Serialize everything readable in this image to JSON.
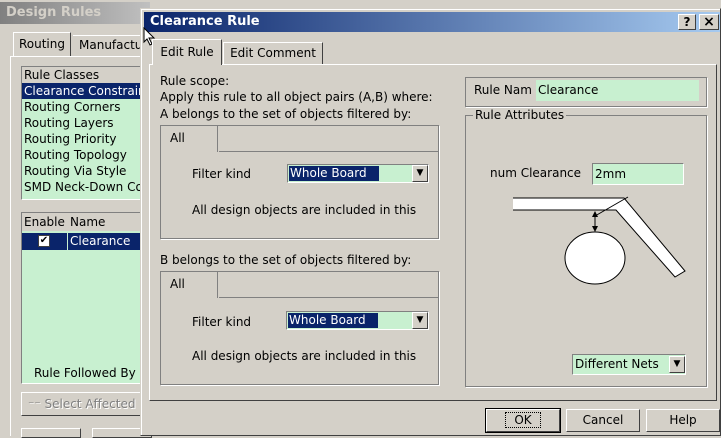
{
  "bg_dialog": {
    "title": "Design Rules",
    "tabs": [
      "Routing",
      "Manufacture"
    ],
    "rule_classes_header": "Rule Classes",
    "rule_classes": [
      "Clearance Constraint",
      "Routing Corners",
      "Routing Layers",
      "Routing Priority",
      "Routing Topology",
      "Routing Via Style",
      "SMD Neck-Down Constraint"
    ],
    "table_headers": {
      "enable": "Enable",
      "name": "Name"
    },
    "table_rows": [
      {
        "enabled": true,
        "name": "Clearance"
      }
    ],
    "rule_followed_label": "Rule Followed By",
    "select_affected_label": "Select Affected"
  },
  "dialog": {
    "title": "Clearance Rule",
    "help_btn": "?",
    "close_btn": "×",
    "tabs": [
      "Edit Rule",
      "Edit Comment"
    ],
    "scope_title": "Rule scope:",
    "scope_desc": "Apply this rule to all object pairs (A,B) where:",
    "a_label": "A belongs to the set of objects filtered by:",
    "b_label": "B belongs to the set of objects filtered by:",
    "filter_tab": "All",
    "filter_kind_label": "Filter kind",
    "filter_kind_value": "Whole Board",
    "filter_desc": "All design objects are included in this",
    "rule_name_label": "Rule Nam",
    "rule_name_value": "Clearance",
    "rule_attributes_label": "Rule Attributes",
    "min_clearance_label": "num Clearance",
    "min_clearance_value": "2mm",
    "nets_value": "Different Nets",
    "ok_label": "OK",
    "cancel_label": "Cancel",
    "help_label": "Help"
  }
}
